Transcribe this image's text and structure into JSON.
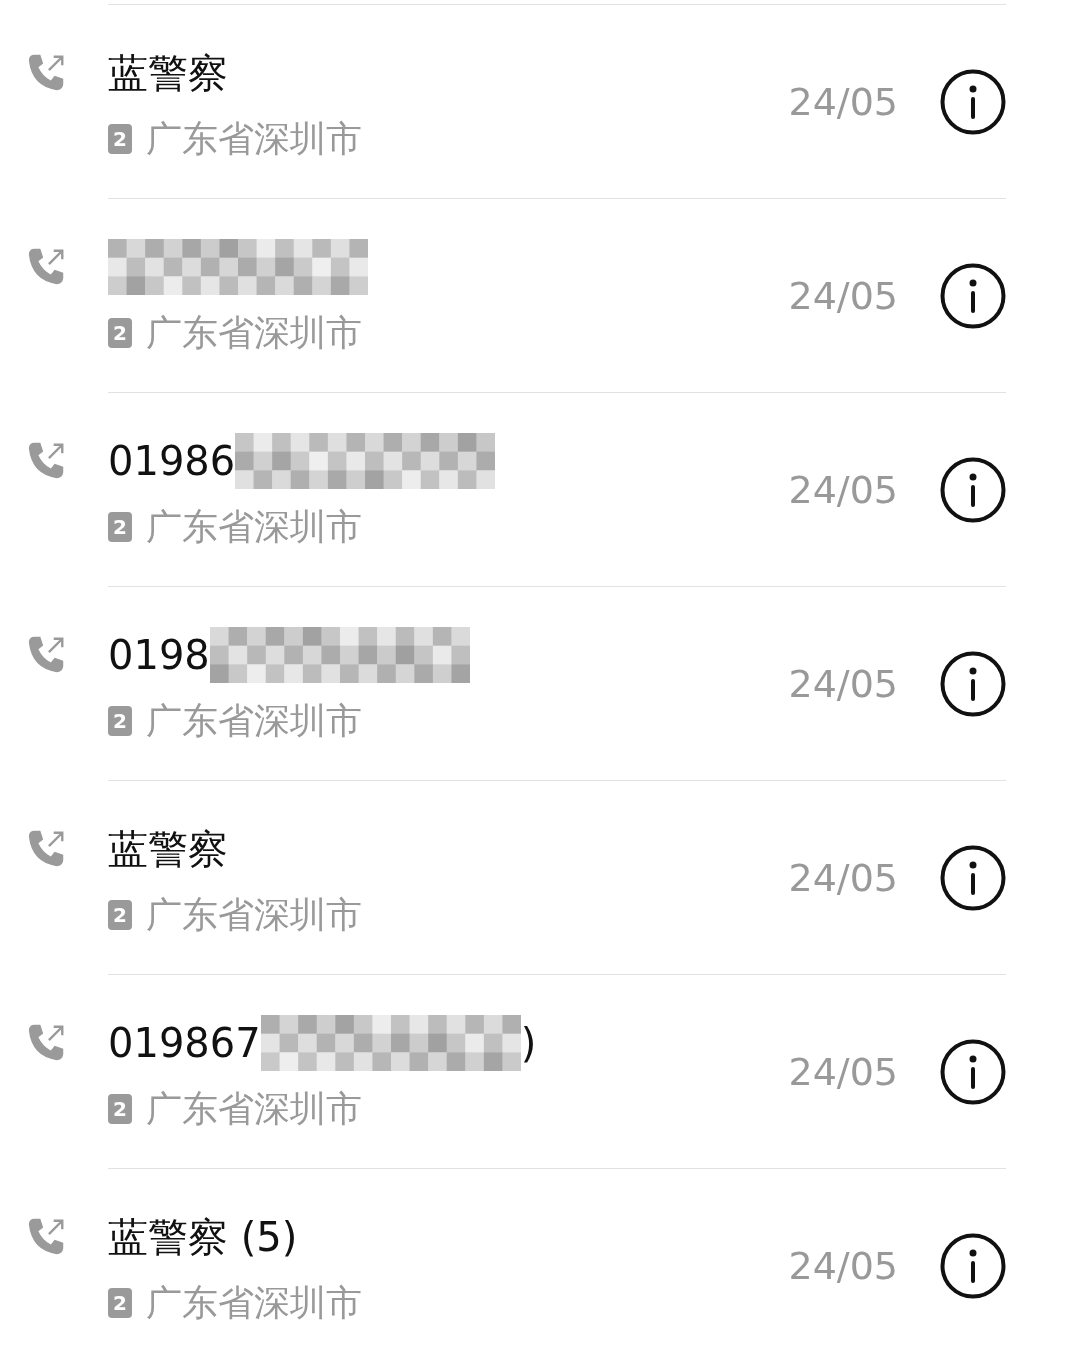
{
  "calls": [
    {
      "kind": "outgoing",
      "name": "蓝警察",
      "redacted": false,
      "sim": "2",
      "location": "广东省深圳市",
      "date": "24/05"
    },
    {
      "kind": "outgoing",
      "redacted": true,
      "sim": "2",
      "location": "广东省深圳市",
      "date": "24/05"
    },
    {
      "kind": "outgoing",
      "name": "01986",
      "redacted": true,
      "sim": "2",
      "location": "广东省深圳市",
      "date": "24/05"
    },
    {
      "kind": "outgoing",
      "name": "0198",
      "redacted": true,
      "sim": "2",
      "location": "广东省深圳市",
      "date": "24/05"
    },
    {
      "kind": "outgoing",
      "name": "蓝警察",
      "redacted": false,
      "sim": "2",
      "location": "广东省深圳市",
      "date": "24/05"
    },
    {
      "kind": "outgoing",
      "name": "019867",
      "redacted": true,
      "suffix": ")",
      "sim": "2",
      "location": "广东省深圳市",
      "date": "24/05"
    },
    {
      "kind": "outgoing",
      "name": "蓝警察 (5)",
      "redacted": false,
      "sim": "2",
      "location": "广东省深圳市",
      "date": "24/05"
    }
  ]
}
